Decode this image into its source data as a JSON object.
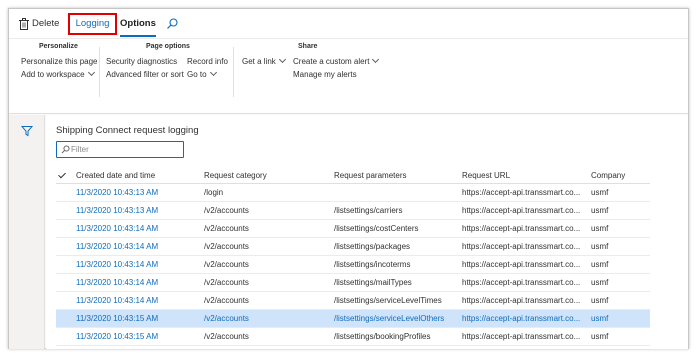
{
  "toolbar": {
    "delete_label": "Delete",
    "logging_tab": "Logging",
    "options_tab": "Options"
  },
  "ribbon": {
    "personalize": {
      "title": "Personalize",
      "items": [
        "Personalize this page",
        "Add to workspace"
      ]
    },
    "page_options": {
      "title": "Page options",
      "items": [
        "Security diagnostics",
        "Advanced filter or sort",
        "Record info",
        "Go to"
      ]
    },
    "get_link": "Get a link",
    "share": {
      "title": "Share",
      "items": [
        "Create a custom alert",
        "Manage my alerts"
      ]
    }
  },
  "page": {
    "title": "Shipping Connect request logging",
    "filter_placeholder": "Filter"
  },
  "grid": {
    "columns": [
      "Created date and time",
      "Request category",
      "Request parameters",
      "Request URL",
      "Company"
    ],
    "rows": [
      {
        "created": "11/3/2020 10:43:13 AM",
        "category": "/login",
        "parameters": "",
        "url": "https://accept-api.transsmart.co...",
        "company": "usmf",
        "selected": false
      },
      {
        "created": "11/3/2020 10:43:13 AM",
        "category": "/v2/accounts",
        "parameters": "/listsettings/carriers",
        "url": "https://accept-api.transsmart.co...",
        "company": "usmf",
        "selected": false
      },
      {
        "created": "11/3/2020 10:43:14 AM",
        "category": "/v2/accounts",
        "parameters": "/listsettings/costCenters",
        "url": "https://accept-api.transsmart.co...",
        "company": "usmf",
        "selected": false
      },
      {
        "created": "11/3/2020 10:43:14 AM",
        "category": "/v2/accounts",
        "parameters": "/listsettings/packages",
        "url": "https://accept-api.transsmart.co...",
        "company": "usmf",
        "selected": false
      },
      {
        "created": "11/3/2020 10:43:14 AM",
        "category": "/v2/accounts",
        "parameters": "/listsettings/incoterms",
        "url": "https://accept-api.transsmart.co...",
        "company": "usmf",
        "selected": false
      },
      {
        "created": "11/3/2020 10:43:14 AM",
        "category": "/v2/accounts",
        "parameters": "/listsettings/mailTypes",
        "url": "https://accept-api.transsmart.co...",
        "company": "usmf",
        "selected": false
      },
      {
        "created": "11/3/2020 10:43:14 AM",
        "category": "/v2/accounts",
        "parameters": "/listsettings/serviceLevelTimes",
        "url": "https://accept-api.transsmart.co...",
        "company": "usmf",
        "selected": false
      },
      {
        "created": "11/3/2020 10:43:15 AM",
        "category": "/v2/accounts",
        "parameters": "/listsettings/serviceLevelOthers",
        "url": "https://accept-api.transsmart.co...",
        "company": "usmf",
        "selected": true
      },
      {
        "created": "11/3/2020 10:43:15 AM",
        "category": "/v2/accounts",
        "parameters": "/listsettings/bookingProfiles",
        "url": "https://accept-api.transsmart.co...",
        "company": "usmf",
        "selected": false
      }
    ]
  },
  "colors": {
    "accent": "#0f6cbd",
    "highlight_box": "#e00000",
    "selected_row": "#cfe4fa"
  },
  "icons": [
    "trash-icon",
    "search-icon",
    "filter-funnel-icon",
    "checkmark-icon",
    "chevron-down-icon"
  ]
}
